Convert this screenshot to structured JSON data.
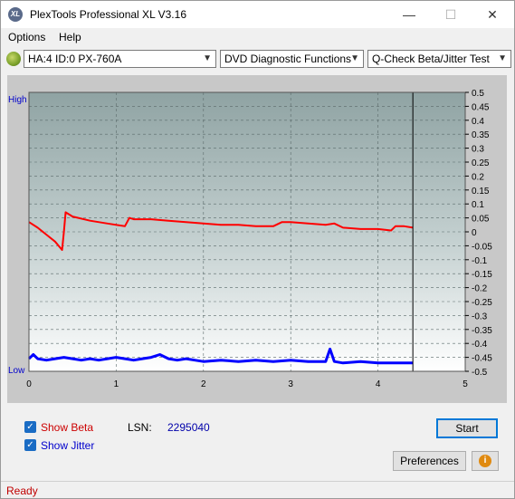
{
  "window": {
    "title": "PlexTools Professional XL V3.16",
    "app_icon_text": "XL",
    "minimize": "—",
    "maximize": "☐",
    "close": "✕"
  },
  "menu": {
    "options_label": "Options",
    "help_label": "Help"
  },
  "toolbar": {
    "drive_select": "HA:4 ID:0  PX-760A",
    "function_select": "DVD Diagnostic Functions",
    "test_select": "Q-Check Beta/Jitter Test"
  },
  "chart_data": {
    "type": "line",
    "left_axis_labels": {
      "high": "High",
      "low": "Low"
    },
    "x_ticks": [
      "0",
      "1",
      "2",
      "3",
      "4",
      "5"
    ],
    "xlim": [
      0,
      5
    ],
    "y_right_ticks": [
      "0.5",
      "0.45",
      "0.4",
      "0.35",
      "0.3",
      "0.25",
      "0.2",
      "0.15",
      "0.1",
      "0.05",
      "0",
      "-0.05",
      "-0.1",
      "-0.15",
      "-0.2",
      "-0.25",
      "-0.3",
      "-0.35",
      "-0.4",
      "-0.45",
      "-0.5"
    ],
    "ylim": [
      -0.5,
      0.5
    ],
    "end_marker_x": 4.4,
    "grid": true,
    "series": [
      {
        "color": "#ff0000",
        "x": [
          0,
          0.1,
          0.2,
          0.3,
          0.38,
          0.4,
          0.42,
          0.5,
          0.7,
          0.9,
          1.1,
          1.15,
          1.2,
          1.4,
          1.6,
          1.8,
          2.0,
          2.2,
          2.4,
          2.6,
          2.8,
          2.9,
          3.0,
          3.2,
          3.4,
          3.5,
          3.6,
          3.8,
          4.0,
          4.15,
          4.2,
          4.3,
          4.4
        ],
        "values": [
          0.035,
          0.015,
          -0.01,
          -0.035,
          -0.065,
          0.0,
          0.07,
          0.055,
          0.04,
          0.03,
          0.02,
          0.05,
          0.045,
          0.045,
          0.04,
          0.035,
          0.03,
          0.025,
          0.025,
          0.02,
          0.02,
          0.035,
          0.035,
          0.03,
          0.025,
          0.03,
          0.015,
          0.01,
          0.01,
          0.005,
          0.02,
          0.02,
          0.015
        ]
      },
      {
        "color": "#0000ff",
        "x": [
          0,
          0.05,
          0.1,
          0.2,
          0.3,
          0.4,
          0.5,
          0.6,
          0.7,
          0.8,
          0.9,
          1.0,
          1.1,
          1.2,
          1.3,
          1.4,
          1.5,
          1.6,
          1.7,
          1.8,
          1.9,
          2.0,
          2.2,
          2.4,
          2.6,
          2.8,
          3.0,
          3.2,
          3.4,
          3.45,
          3.5,
          3.6,
          3.8,
          4.0,
          4.2,
          4.4
        ],
        "values": [
          -0.455,
          -0.44,
          -0.455,
          -0.46,
          -0.455,
          -0.45,
          -0.455,
          -0.46,
          -0.455,
          -0.46,
          -0.455,
          -0.45,
          -0.455,
          -0.46,
          -0.455,
          -0.45,
          -0.44,
          -0.455,
          -0.46,
          -0.455,
          -0.46,
          -0.465,
          -0.46,
          -0.465,
          -0.46,
          -0.465,
          -0.46,
          -0.465,
          -0.465,
          -0.42,
          -0.465,
          -0.47,
          -0.465,
          -0.47,
          -0.47,
          -0.47
        ]
      }
    ]
  },
  "bottom": {
    "show_beta_label": "Show Beta",
    "show_jitter_label": "Show Jitter",
    "lsn_label": "LSN:",
    "lsn_value": "2295040",
    "start_label": "Start",
    "preferences_label": "Preferences",
    "info_icon_text": "i"
  },
  "status": {
    "text": "Ready"
  },
  "colors": {
    "beta": "#ff0000",
    "jitter": "#0000ff",
    "status_text": "#c00000"
  }
}
